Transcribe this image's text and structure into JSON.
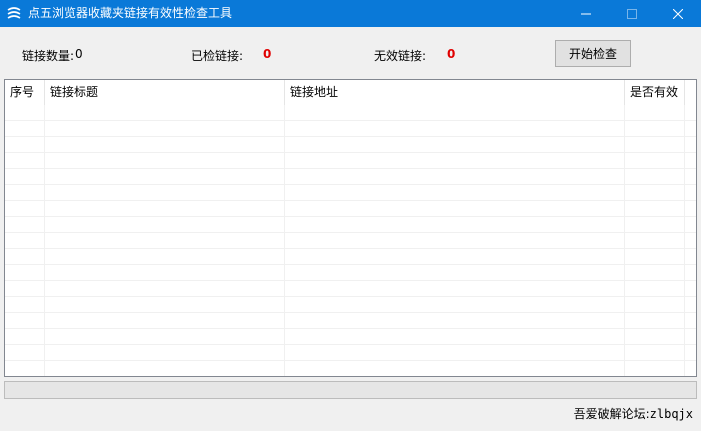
{
  "window": {
    "title": "点五浏览器收藏夹链接有效性检查工具",
    "minimize_icon": "minimize-icon",
    "maximize_icon": "maximize-icon",
    "close_icon": "close-icon"
  },
  "stats": {
    "link_count_label": "链接数量:",
    "link_count_value": "0",
    "checked_label": "已检链接:",
    "checked_value": "0",
    "invalid_label": "无效链接:",
    "invalid_value": "0",
    "value_color": "#e00000"
  },
  "actions": {
    "start_label": "开始检查"
  },
  "table": {
    "columns": [
      "序号",
      "链接标题",
      "链接地址",
      "是否有效"
    ],
    "rows": []
  },
  "progress": {
    "fraction": 0
  },
  "footer": {
    "label": "吾爱破解论坛:",
    "value": "zlbqjx"
  }
}
